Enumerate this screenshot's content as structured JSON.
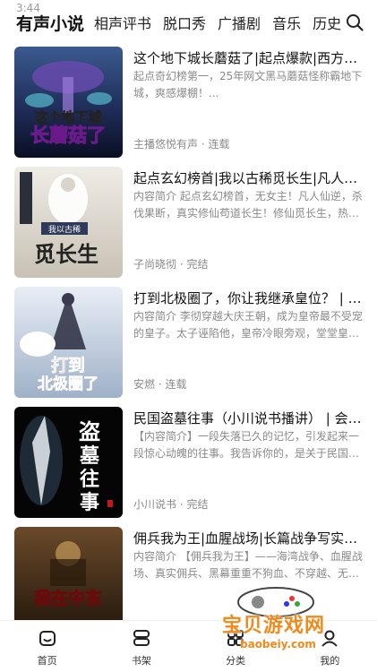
{
  "status": {
    "time": "3:44"
  },
  "nav": {
    "tabs": [
      {
        "label": "有声小说"
      },
      {
        "label": "相声评书"
      },
      {
        "label": "脱口秀"
      },
      {
        "label": "广播剧"
      },
      {
        "label": "音乐"
      },
      {
        "label": "历史"
      }
    ],
    "search_icon": "search-icon"
  },
  "books": [
    {
      "title": "这个地下城长蘑菇了|起点爆款|西方奇幻...",
      "desc": "起点奇幻榜第一，25年网文黑马蘑菇怪称霸地下城，爽感爆棚！...",
      "meta": "主播悠悦有声 · 连载",
      "cover_text": "这个地下城长蘑菇了",
      "cover_colors": [
        "#2a3f6b",
        "#0e1730"
      ]
    },
    {
      "title": "起点玄幻榜首|我以古稀觅长生|凡人仙逆...",
      "desc": "内容简介 起点玄幻榜首，无女主！凡人仙逆，杀伐果断，真实修仙苟道长生！修仙觅长生，热血...",
      "meta": "子尚晓彻 · 完结",
      "cover_text": "我以古稀觅长生",
      "cover_colors": [
        "#e9e6df",
        "#c9c3b8"
      ]
    },
    {
      "title": "打到北极圈了，你让我继承皇位？ | 历...",
      "desc": "内容简介 李彻穿越大庆王朝，成为皇帝最不受宠的皇子。太子诬陷他，皇帝冷眼旁观，堂堂皇子...",
      "meta": "安燃 · 连载",
      "cover_text": "打到北极圈了",
      "cover_colors": [
        "#dfe7f0",
        "#a8b8cc"
      ]
    },
    {
      "title": "民国盗墓往事（小川说书播讲） | 会员...",
      "desc": "【内容简介】一段失落已久的记忆，引发起来一段惊心动魄的往事。我告诉你的，是关于民国期...",
      "meta": "小川说书 · 完结",
      "cover_text": "盗墓往事",
      "cover_colors": [
        "#1a1a1a",
        "#000000"
      ]
    },
    {
      "title": "佣兵我为王|血腥战场|长篇战争写实巨著...",
      "desc": "内容简介 【佣兵我为王】——海湾战争、血腥战场、真实佣兵、黑幕重重不狗血、不穿越、无女...",
      "meta": "",
      "cover_text": "我在中东",
      "cover_colors": [
        "#3a2a1a",
        "#1a120a"
      ]
    }
  ],
  "bottom_nav": [
    {
      "label": "首页",
      "icon": "home-icon"
    },
    {
      "label": "书架",
      "icon": "bookshelf-icon"
    },
    {
      "label": "分类",
      "icon": "category-icon"
    },
    {
      "label": "我的",
      "icon": "profile-icon"
    }
  ],
  "watermark": {
    "text": "宝贝游戏网",
    "url": "baobeiy.com"
  }
}
